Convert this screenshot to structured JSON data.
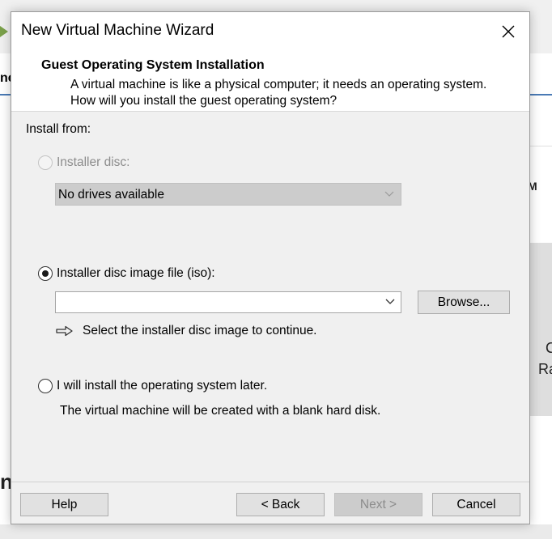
{
  "background": {
    "tab_fragment": "ne",
    "right_text_m": "M",
    "right_text_c": "C",
    "right_text_ra": "Ra",
    "left_text_n": "n"
  },
  "dialog": {
    "title": "New Virtual Machine Wizard",
    "header": {
      "title": "Guest Operating System Installation",
      "description": "A virtual machine is like a physical computer; it needs an operating system. How will you install the guest operating system?"
    },
    "install_from_label": "Install from:",
    "options": {
      "installer_disc": {
        "label": "Installer disc:",
        "selected": false,
        "enabled": false,
        "drive_value": "No drives available"
      },
      "iso": {
        "label": "Installer disc image file (iso):",
        "selected": true,
        "path_value": "",
        "browse_label": "Browse...",
        "hint": "Select the installer disc image to continue."
      },
      "later": {
        "label": "I will install the operating system later.",
        "selected": false,
        "description": "The virtual machine will be created with a blank hard disk."
      }
    },
    "buttons": {
      "help": "Help",
      "back": "< Back",
      "next": "Next >",
      "cancel": "Cancel"
    }
  },
  "colors": {
    "body_bg": "#f0f0f0",
    "button_bg": "#e1e1e1",
    "disabled_text": "#8c8c8c",
    "accent": "#4a7ab5"
  }
}
